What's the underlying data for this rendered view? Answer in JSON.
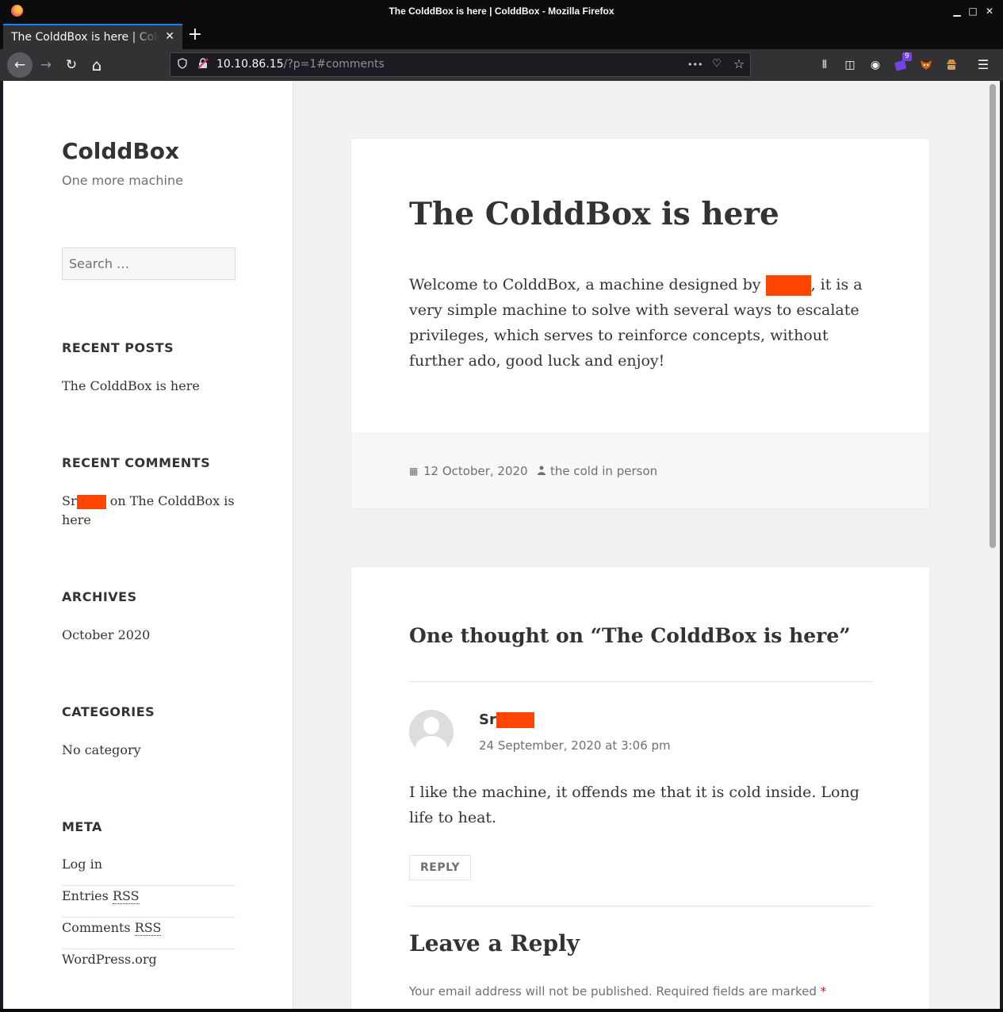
{
  "window": {
    "title": "The ColddBox is here | ColddBox - Mozilla Firefox",
    "minimize": "▁",
    "maximize": "□",
    "close": "✕"
  },
  "tab": {
    "title": "The ColddBox is here | ColddBox",
    "close": "✕",
    "new_tab": "+"
  },
  "toolbar": {
    "back": "←",
    "forward": "→",
    "reload": "↻",
    "home": "⌂",
    "url_host": "10.10.86.15",
    "url_rest": "/?p=1#comments",
    "page_actions": "•••",
    "pocket": "♡",
    "bookmark": "☆",
    "library": "⫴",
    "sidebar": "◫",
    "account": "◉",
    "ext_badge": "9",
    "menu": "☰"
  },
  "sidebar": {
    "site_title": "ColddBox",
    "site_description": "One more machine",
    "search_placeholder": "Search …",
    "recent_posts_title": "RECENT POSTS",
    "recent_post": "The ColddBox is here",
    "recent_comments_title": "RECENT COMMENTS",
    "comment_author_prefix": "Sr",
    "comment_on": "on",
    "comment_post_line1": "The ColddBox is",
    "comment_post_line2": "here",
    "archives_title": "ARCHIVES",
    "archive": "October 2020",
    "categories_title": "CATEGORIES",
    "category": "No category",
    "meta_title": "META",
    "meta_login": "Log in",
    "meta_entries_prefix": "Entries ",
    "meta_comments_prefix": "Comments ",
    "meta_rss": "RSS",
    "meta_wordpress": "WordPress.org"
  },
  "post": {
    "title": "The ColddBox is here",
    "body_start": "Welcome to ColddBox, a machine designed by ",
    "body_end": ", it is a very simple machine to solve with several ways to escalate privileges, which serves to reinforce concepts, without further ado, good luck and enjoy!",
    "date": "12 October, 2020",
    "author": "the cold in person",
    "date_icon": "▦",
    "author_icon": "👤"
  },
  "comments": {
    "title": "One thought on “The ColddBox is here”",
    "author_prefix": "Sr",
    "date": "24 September, 2020 at 3:06 pm",
    "text": "I like the machine, it offends me that it is cold inside. Long life to heat.",
    "reply_label": "REPLY",
    "leave_reply": "Leave a Reply",
    "notes": "Your email address will not be published. Required fields are marked ",
    "required_mark": "*"
  },
  "colors": {
    "redaction": "#ff4500",
    "tab_accent": "#0a84ff"
  }
}
